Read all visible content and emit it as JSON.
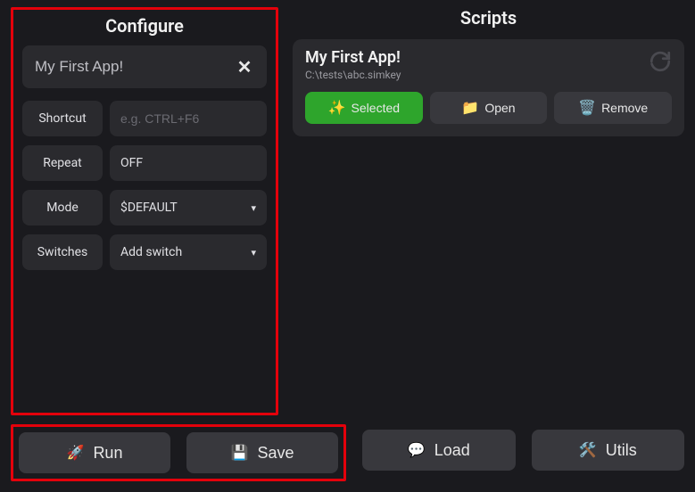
{
  "configure": {
    "title": "Configure",
    "app_name": "My First App!",
    "fields": {
      "shortcut_label": "Shortcut",
      "shortcut_placeholder": "e.g. CTRL+F6",
      "shortcut_value": "",
      "repeat_label": "Repeat",
      "repeat_value": "OFF",
      "mode_label": "Mode",
      "mode_value": "$DEFAULT",
      "switches_label": "Switches",
      "switches_value": "Add switch"
    }
  },
  "scripts": {
    "title": "Scripts",
    "items": [
      {
        "title": "My First App!",
        "path": "C:\\tests\\abc.simkey",
        "selected_label": "Selected",
        "open_label": "Open",
        "remove_label": "Remove"
      }
    ]
  },
  "actions": {
    "run": "Run",
    "save": "Save",
    "load": "Load",
    "utils": "Utils"
  }
}
